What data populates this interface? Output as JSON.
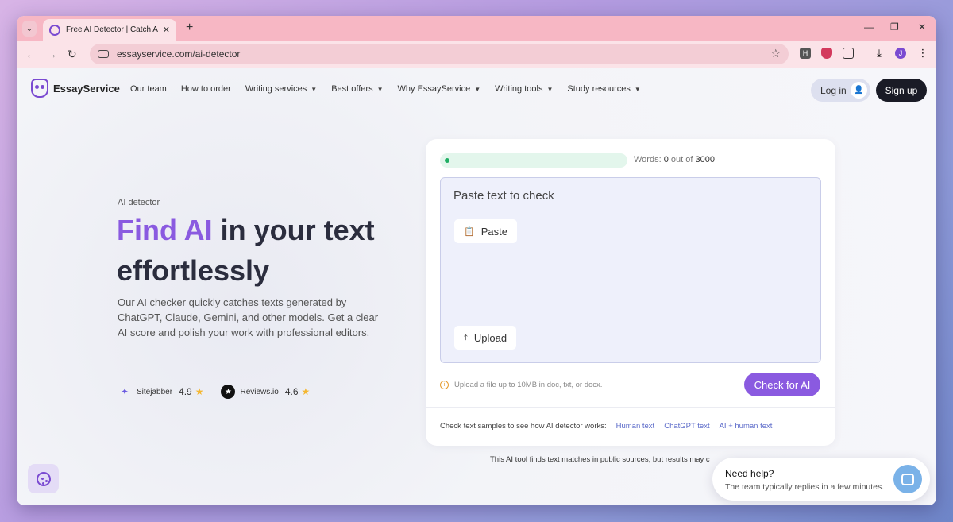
{
  "browser": {
    "tab_title": "Free AI Detector | Catch AI Cont",
    "url": "essayservice.com/ai-detector",
    "profile_initial": "J",
    "ext_h_label": "H"
  },
  "nav": {
    "brand": "EssayService",
    "links": [
      "Our team",
      "How to order",
      "Writing services",
      "Best offers",
      "Why EssayService",
      "Writing tools",
      "Study resources"
    ],
    "login_label": "Log in",
    "signup_label": "Sign up"
  },
  "hero": {
    "eyebrow": "AI detector",
    "headline_accent": "Find AI",
    "headline_rest": " in your text effortlessly",
    "description": "Our AI checker quickly catches texts generated by ChatGPT, Claude, Gemini, and other models. Get a clear AI score and polish your work with professional editors.",
    "ratings": [
      {
        "name": "Sitejabber",
        "score": "4.9"
      },
      {
        "name": "Reviews.io",
        "score": "4.6"
      }
    ]
  },
  "detector": {
    "progress": 0,
    "words_label": "Words:",
    "words_count": "0",
    "words_sep": "out of",
    "words_max": "3000",
    "placeholder": "Paste text to check",
    "paste_label": "Paste",
    "upload_label": "Upload",
    "hint": "Upload a file up to 10MB in doc, txt, or docx.",
    "check_label": "Check for AI",
    "samples_intro": "Check text samples to see how AI detector works:",
    "samples": [
      "Human text",
      "ChatGPT text",
      "AI + human text"
    ]
  },
  "disclaimer": "This AI tool finds text matches in public sources, but results may c",
  "help": {
    "title": "Need help?",
    "subtitle": "The team typically replies in a few minutes."
  },
  "colors": {
    "accent": "#8a5ae0",
    "tabstrip": "#f7b7c4",
    "success": "#1fae63"
  }
}
